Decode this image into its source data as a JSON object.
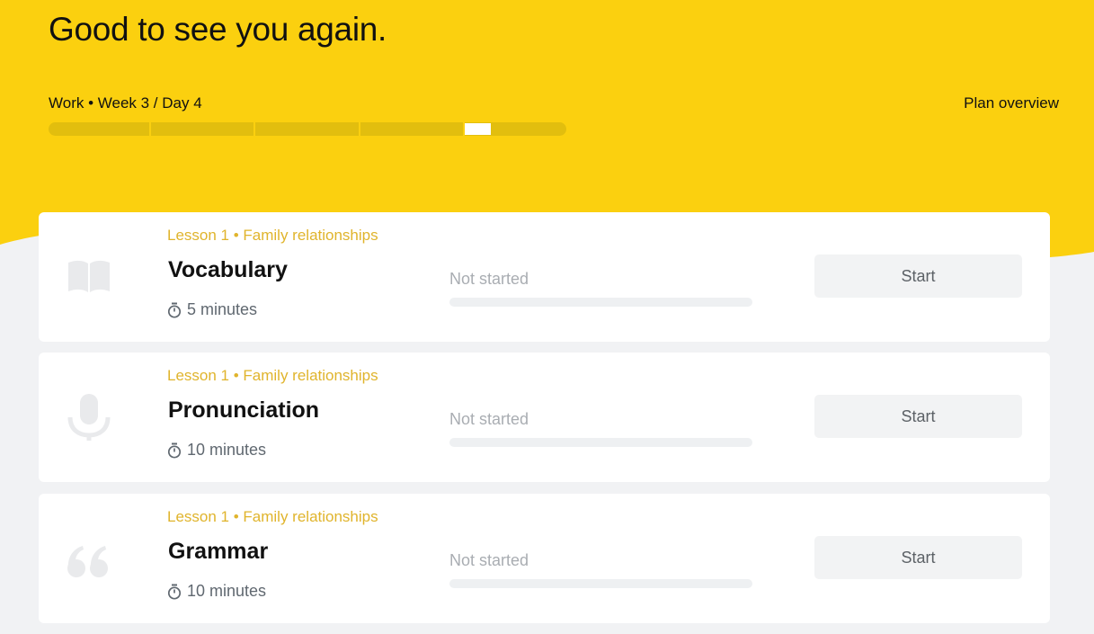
{
  "header": {
    "greeting": "Good to see you again.",
    "plan_label": "Work • Week 3 / Day 4",
    "plan_overview_link": "Plan overview",
    "plan_progress": {
      "segments": 5,
      "current_segment": 5,
      "current_segment_fraction": 0.25
    }
  },
  "colors": {
    "brand_yellow": "#fbd00f",
    "lesson_meta": "#e0b42c",
    "page_background": "#f1f2f4"
  },
  "lessons": [
    {
      "meta": "Lesson 1 • Family relationships",
      "title": "Vocabulary",
      "duration": "5 minutes",
      "status": "Not started",
      "progress": 0,
      "action": "Start",
      "icon": "book-icon"
    },
    {
      "meta": "Lesson 1 • Family relationships",
      "title": "Pronunciation",
      "duration": "10 minutes",
      "status": "Not started",
      "progress": 0,
      "action": "Start",
      "icon": "microphone-icon"
    },
    {
      "meta": "Lesson 1 • Family relationships",
      "title": "Grammar",
      "duration": "10 minutes",
      "status": "Not started",
      "progress": 0,
      "action": "Start",
      "icon": "quote-icon"
    }
  ]
}
